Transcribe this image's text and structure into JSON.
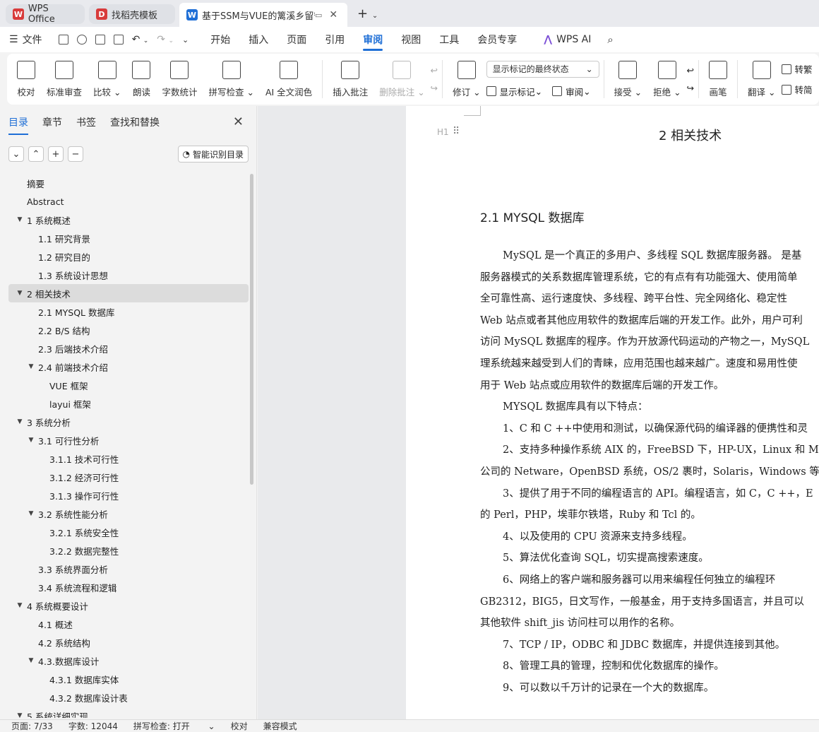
{
  "tabs": [
    {
      "label": "WPS Office",
      "logo": "W",
      "color": "#d83b3b"
    },
    {
      "label": "找稻壳模板",
      "logo": "D",
      "color": "#d83b3b"
    },
    {
      "label": "基于SSM与VUE的篱溪乡留守",
      "logo": "W",
      "color": "#1f6fd6"
    }
  ],
  "menu": {
    "file": "文件",
    "items": [
      "开始",
      "插入",
      "页面",
      "引用",
      "审阅",
      "视图",
      "工具",
      "会员专享"
    ],
    "active": "审阅",
    "ai": "WPS AI"
  },
  "ribbon": {
    "proof": "校对",
    "std_review": "标准审查",
    "compare": "比较",
    "read_aloud": "朗读",
    "word_count": "字数统计",
    "spell": "拼写检查",
    "ai_polish": "AI 全文润色",
    "insert_comment": "插入批注",
    "delete_comment": "删除批注",
    "track": "修订",
    "show_state": "显示标记的最终状态",
    "show_marks": "显示标记",
    "review_pane": "审阅",
    "accept": "接受",
    "reject": "拒绝",
    "pen": "画笔",
    "translate": "翻译",
    "to_trad": "转繁",
    "to_simp": "转简"
  },
  "nav": {
    "tabs": [
      "目录",
      "章节",
      "书签",
      "查找和替换"
    ],
    "smart_btn": "智能识别目录",
    "toc": [
      {
        "label": "摘要",
        "level": 1,
        "caret": false
      },
      {
        "label": "Abstract",
        "level": 1,
        "caret": false
      },
      {
        "label": "1 系统概述",
        "level": 1,
        "caret": true
      },
      {
        "label": "1.1  研究背景",
        "level": 2,
        "caret": false
      },
      {
        "label": "1.2 研究目的",
        "level": 2,
        "caret": false
      },
      {
        "label": "1.3 系统设计思想",
        "level": 2,
        "caret": false
      },
      {
        "label": "2 相关技术",
        "level": 1,
        "caret": true,
        "selected": true
      },
      {
        "label": "2.1 MYSQL 数据库",
        "level": 2,
        "caret": false
      },
      {
        "label": "2.2 B/S 结构",
        "level": 2,
        "caret": false
      },
      {
        "label": "2.3  后端技术介绍",
        "level": 2,
        "caret": false
      },
      {
        "label": "2.4  前端技术介绍",
        "level": 2,
        "caret": true
      },
      {
        "label": "VUE 框架",
        "level": 3,
        "caret": false
      },
      {
        "label": "layui 框架",
        "level": 3,
        "caret": false
      },
      {
        "label": "3 系统分析",
        "level": 1,
        "caret": true
      },
      {
        "label": "3.1 可行性分析",
        "level": 2,
        "caret": true
      },
      {
        "label": "3.1.1 技术可行性",
        "level": 3,
        "caret": false
      },
      {
        "label": "3.1.2 经济可行性",
        "level": 3,
        "caret": false
      },
      {
        "label": "3.1.3 操作可行性",
        "level": 3,
        "caret": false
      },
      {
        "label": "3.2 系统性能分析",
        "level": 2,
        "caret": true
      },
      {
        "label": "3.2.1  系统安全性",
        "level": 3,
        "caret": false
      },
      {
        "label": "3.2.2  数据完整性",
        "level": 3,
        "caret": false
      },
      {
        "label": "3.3 系统界面分析",
        "level": 2,
        "caret": false
      },
      {
        "label": "3.4 系统流程和逻辑",
        "level": 2,
        "caret": false
      },
      {
        "label": "4 系统概要设计",
        "level": 1,
        "caret": true
      },
      {
        "label": "4.1 概述",
        "level": 2,
        "caret": false
      },
      {
        "label": "4.2 系统结构",
        "level": 2,
        "caret": false
      },
      {
        "label": "4.3.数据库设计",
        "level": 2,
        "caret": true
      },
      {
        "label": "4.3.1 数据库实体",
        "level": 3,
        "caret": false
      },
      {
        "label": "4.3.2 数据库设计表",
        "level": 3,
        "caret": false
      },
      {
        "label": "5 系统详细实现",
        "level": 1,
        "caret": true
      }
    ]
  },
  "doc": {
    "h1": "2 相关技术",
    "h2": "2.1 MYSQL 数据库",
    "hmark": "H1",
    "lines": [
      {
        "text": "MySQL 是一个真正的多用户、多线程 SQL 数据库服务器。 是基",
        "indent": true
      },
      {
        "text": "服务器模式的关系数据库管理系统，它的有点有有功能强大、使用简单",
        "indent": false
      },
      {
        "text": "全可靠性高、运行速度快、多线程、跨平台性、完全网络化、稳定性",
        "indent": false
      },
      {
        "text": "Web 站点或者其他应用软件的数据库后端的开发工作。此外，用户可利",
        "indent": false
      },
      {
        "text": "访问 MySQL 数据库的程序。作为开放源代码运动的产物之一，MySQL",
        "indent": false
      },
      {
        "text": "理系统越来越受到人们的青睐，应用范围也越来越广。速度和易用性使",
        "indent": false
      },
      {
        "text": "用于 Web 站点或应用软件的数据库后端的开发工作。",
        "indent": false
      },
      {
        "text": "MYSQL 数据库具有以下特点：",
        "indent": true
      },
      {
        "text": "1、C 和 C ++中使用和测试，以确保源代码的编译器的便携性和灵",
        "indent": true
      },
      {
        "text": "2、支持多种操作系统 AIX 的，FreeBSD 下，HP-UX，Linux 和 Ma",
        "indent": true
      },
      {
        "text": "公司的 Netware，OpenBSD 系统，OS/2 裹时，Solaris，Windows 等。",
        "indent": false
      },
      {
        "text": "3、提供了用于不同的编程语言的 API。编程语言，如 C，C ++，E",
        "indent": true
      },
      {
        "text": "的 Perl，PHP，埃菲尔铁塔，Ruby 和 Tcl 的。",
        "indent": false
      },
      {
        "text": "4、以及使用的 CPU 资源来支持多线程。",
        "indent": true
      },
      {
        "text": "5、算法优化查询 SQL，切实提高搜索速度。",
        "indent": true
      },
      {
        "text": "6、网络上的客户端和服务器可以用来编程任何独立的编程环",
        "indent": true
      },
      {
        "text": "GB2312，BIG5，日文写作，一般基金，用于支持多国语言，并且可以",
        "indent": false
      },
      {
        "text": "其他软件 shift_jis 访问柱可以用作的名称。",
        "indent": false
      },
      {
        "text": "7、TCP / IP，ODBC 和 JDBC 数据库，并提供连接到其他。",
        "indent": true
      },
      {
        "text": "8、管理工具的管理，控制和优化数据库的操作。",
        "indent": true
      },
      {
        "text": "9、可以数以千万计的记录在一个大的数据库。",
        "indent": true
      }
    ]
  },
  "status": {
    "page": "页面: 7/33",
    "words": "字数: 12044",
    "spell": "拼写检查: 打开",
    "proof": "校对",
    "compat": "兼容模式"
  }
}
